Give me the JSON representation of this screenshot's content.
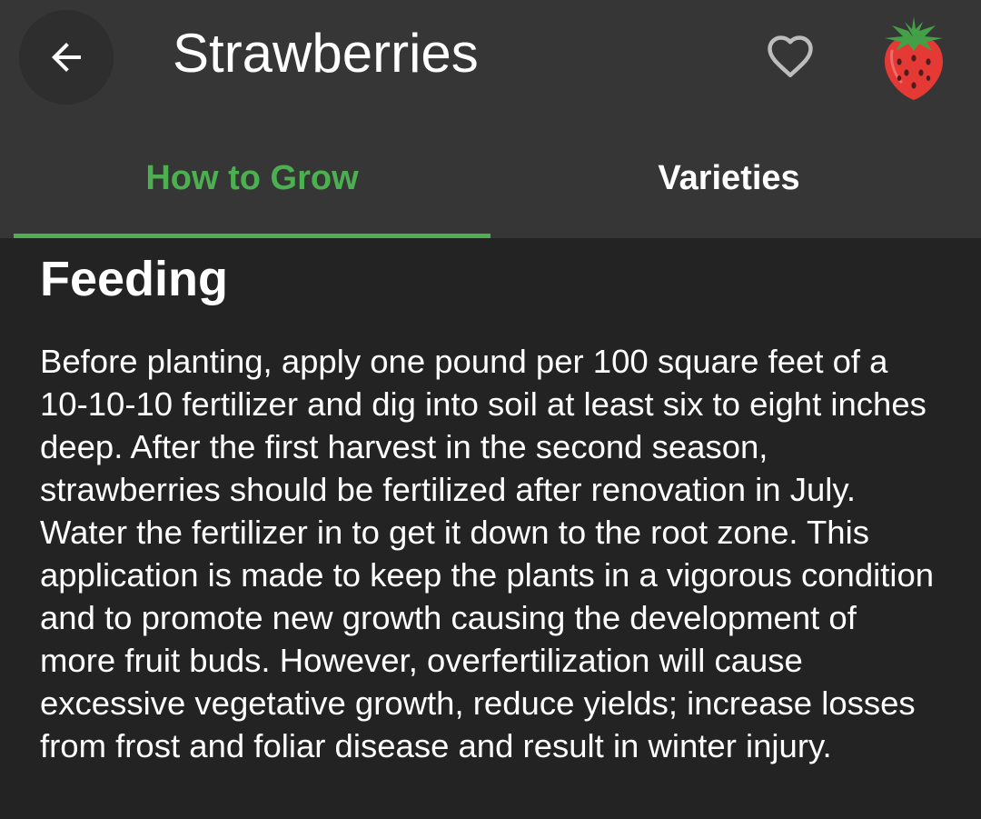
{
  "header": {
    "title": "Strawberries",
    "back_icon": "arrow-left-icon",
    "favorite_icon": "heart-outline-icon",
    "plant_icon": "strawberry-icon"
  },
  "tabs": [
    {
      "label": "How to Grow",
      "active": true
    },
    {
      "label": "Varieties",
      "active": false
    }
  ],
  "section": {
    "heading": "Feeding",
    "body": "Before planting, apply one pound per 100 square feet of a 10-10-10 fertilizer and dig into soil at least six to eight inches deep. After the first harvest in the second season, strawberries should be fertilized after renovation in July. Water the fertilizer in to get it down to the root zone. This application is made to keep the plants in a vigorous condition and to promote new growth causing the development of more fruit buds. However, overfertilization will cause excessive vegetative growth, reduce yields; increase losses from frost and foliar disease and result in winter injury."
  },
  "colors": {
    "appbar": "#363636",
    "background": "#232323",
    "accent": "#4caf50",
    "text": "#ffffff"
  }
}
